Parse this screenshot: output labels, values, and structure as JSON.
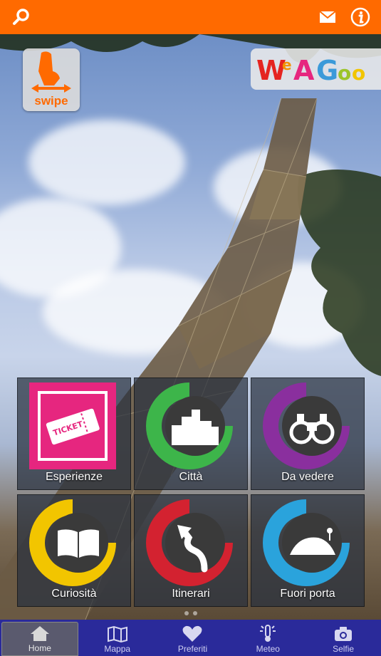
{
  "topbar": {
    "color": "#ff6a00",
    "icons": [
      "search-icon",
      "mail-icon",
      "info-icon"
    ]
  },
  "badges": {
    "swipe_label": "swipe",
    "logo_text": "WeAGoo"
  },
  "tiles": [
    {
      "label": "Esperienze",
      "icon": "ticket-icon",
      "color": "#e6267f"
    },
    {
      "label": "Città",
      "icon": "city-icon",
      "color": "#3db54a"
    },
    {
      "label": "Da vedere",
      "icon": "binoculars-icon",
      "color": "#8a2f9e"
    },
    {
      "label": "Curiosità",
      "icon": "book-icon",
      "color": "#f2c500"
    },
    {
      "label": "Itinerari",
      "icon": "route-icon",
      "color": "#d32230"
    },
    {
      "label": "Fuori porta",
      "icon": "landscape-icon",
      "color": "#2aa3dc"
    }
  ],
  "nav": {
    "items": [
      {
        "label": "Home",
        "icon": "home-icon",
        "active": true
      },
      {
        "label": "Mappa",
        "icon": "map-icon"
      },
      {
        "label": "Preferiti",
        "icon": "heart-icon"
      },
      {
        "label": "Meteo",
        "icon": "weather-icon"
      },
      {
        "label": "Selfie",
        "icon": "camera-icon"
      }
    ]
  }
}
